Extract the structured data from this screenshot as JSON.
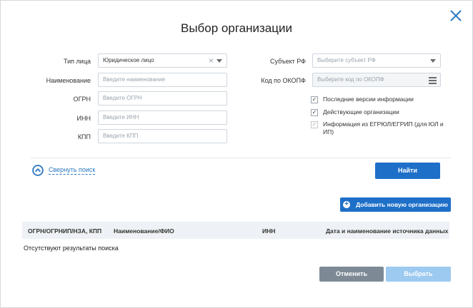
{
  "dialog": {
    "title": "Выбор организации"
  },
  "form": {
    "left": [
      {
        "label": "Тип лица",
        "value": "Юридическое лицо",
        "placeholder": ""
      },
      {
        "label": "Наименование",
        "value": "",
        "placeholder": "Введите наименование"
      },
      {
        "label": "ОГРН",
        "value": "",
        "placeholder": "Введите ОГРН"
      },
      {
        "label": "ИНН",
        "value": "",
        "placeholder": "Введите ИНН"
      },
      {
        "label": "КПП",
        "value": "",
        "placeholder": "Введите КПП"
      }
    ],
    "subject": {
      "label": "Субъект РФ",
      "placeholder": "Выберите субъект РФ"
    },
    "okopf": {
      "label": "Код по ОКОПФ",
      "placeholder": "Выберите код по ОКОПФ"
    },
    "checkboxes": [
      {
        "label": "Последние версии информации",
        "checked": true,
        "disabled": false
      },
      {
        "label": "Действующие организации",
        "checked": true,
        "disabled": false
      },
      {
        "label": "Информация из ЕГРЮЛ/ЕГРИП (для ЮЛ и ИП)",
        "checked": true,
        "disabled": true
      }
    ],
    "collapse_label": "Свернуть поиск",
    "find_label": "Найти"
  },
  "results": {
    "add_label": "Добавить новую организацию",
    "columns": [
      "ОГРН/ОГРНИП/НЗА, КПП",
      "Наименование/ФИО",
      "ИНН",
      "Дата и наименование источника данных"
    ],
    "empty_text": "Отсутствуют результаты поиска"
  },
  "footer": {
    "cancel_label": "Отменить",
    "select_label": "Выбрать"
  },
  "colors": {
    "primary": "#1e6fc8",
    "primary_disabled": "#9ccaf0",
    "secondary": "#7d8a96"
  }
}
